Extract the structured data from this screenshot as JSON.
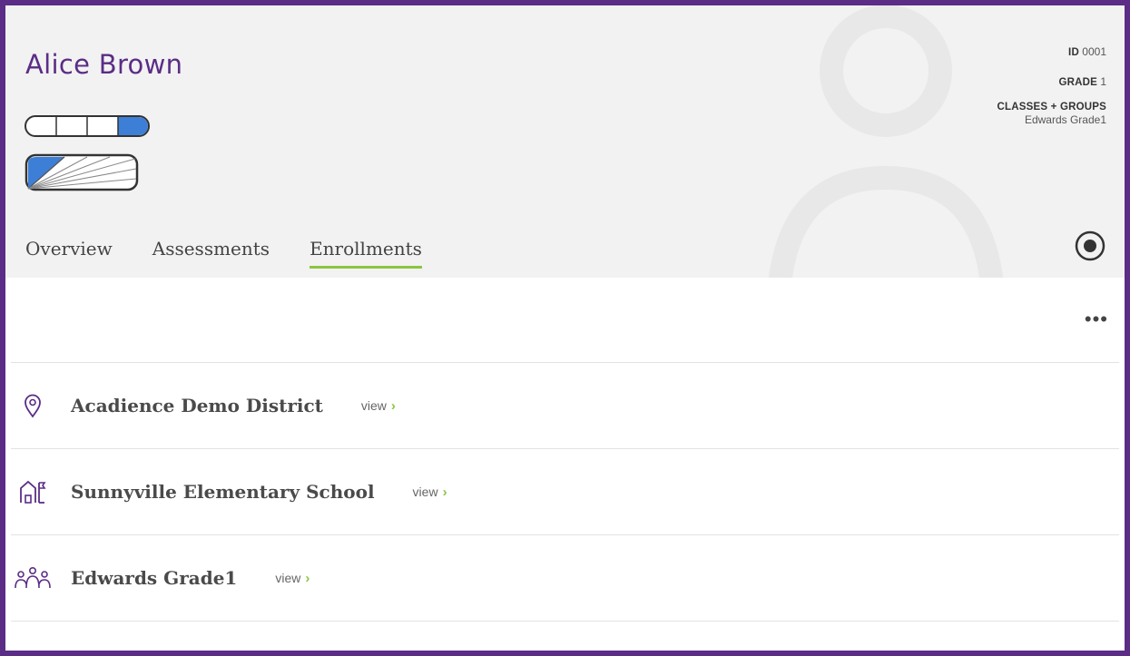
{
  "student": {
    "name": "Alice Brown",
    "id_label": "ID",
    "id_value": "0001",
    "grade_label": "GRADE",
    "grade_value": "1",
    "classes_label": "CLASSES + GROUPS",
    "classes_value": "Edwards Grade1"
  },
  "tabs": [
    {
      "label": "Overview",
      "active": false
    },
    {
      "label": "Assessments",
      "active": false
    },
    {
      "label": "Enrollments",
      "active": true
    }
  ],
  "toolbar": {
    "more_label": "•••"
  },
  "enrollments": [
    {
      "icon": "location-pin-icon",
      "name": "Acadience Demo District",
      "view_label": "view",
      "chevron": "›"
    },
    {
      "icon": "school-icon",
      "name": "Sunnyville Elementary School",
      "view_label": "view",
      "chevron": "›"
    },
    {
      "icon": "group-icon",
      "name": "Edwards Grade1",
      "view_label": "view",
      "chevron": "›"
    }
  ],
  "colors": {
    "frame": "#5b2d86",
    "name": "#5b2d86",
    "accent_green": "#8cc63f",
    "meter_blue": "#3d7fd6",
    "header_bg": "#f2f2f2"
  }
}
